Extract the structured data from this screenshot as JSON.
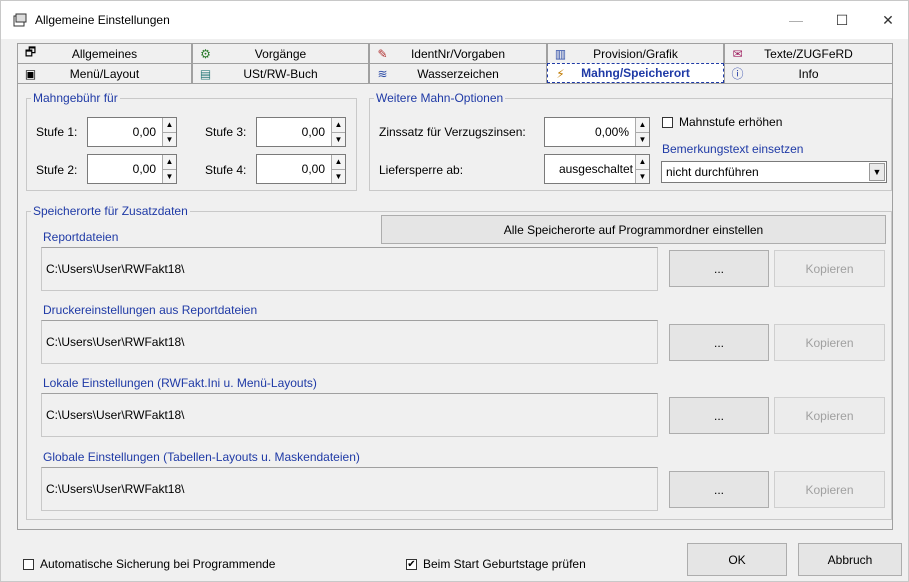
{
  "window": {
    "title": "Allgemeine Einstellungen",
    "minimize_glyph": "—",
    "maximize_glyph": "☐",
    "close_glyph": "✕"
  },
  "tabs": {
    "row1": [
      {
        "label": "Allgemeines",
        "icon": "settings-icon"
      },
      {
        "label": "Vorgänge",
        "icon": "process-icon"
      },
      {
        "label": "IdentNr/Vorgaben",
        "icon": "ident-icon"
      },
      {
        "label": "Provision/Grafik",
        "icon": "chart-icon"
      },
      {
        "label": "Texte/ZUGFeRD",
        "icon": "text-icon"
      }
    ],
    "row2": [
      {
        "label": "Menü/Layout",
        "icon": "layout-icon"
      },
      {
        "label": "USt/RW-Buch",
        "icon": "book-icon"
      },
      {
        "label": "Wasserzeichen",
        "icon": "watermark-icon"
      },
      {
        "label": "Mahng/Speicherort",
        "icon": "reminder-icon"
      },
      {
        "label": "Info",
        "icon": "info-icon"
      }
    ],
    "active": "Mahng/Speicherort"
  },
  "mahngebuehr": {
    "legend": "Mahngebühr für",
    "stufe1": {
      "label": "Stufe 1:",
      "value": "0,00"
    },
    "stufe2": {
      "label": "Stufe 2:",
      "value": "0,00"
    },
    "stufe3": {
      "label": "Stufe 3:",
      "value": "0,00"
    },
    "stufe4": {
      "label": "Stufe 4:",
      "value": "0,00"
    }
  },
  "mahnoptionen": {
    "legend": "Weitere Mahn-Optionen",
    "zinssatz_label": "Zinssatz für Verzugszinsen:",
    "zinssatz_value": "0,00%",
    "liefersperre_label": "Liefersperre ab:",
    "liefersperre_value": "ausgeschaltet",
    "mahnstufe_checkbox": {
      "label": "Mahnstufe erhöhen",
      "checked": false
    },
    "bemerkung_label": "Bemerkungstext einsetzen",
    "bemerkung_value": "nicht durchführen"
  },
  "speicherorte": {
    "legend": "Speicherorte für Zusatzdaten",
    "set_all_button": "Alle Speicherorte auf Programmordner einstellen",
    "browse_label": "...",
    "copy_label": "Kopieren",
    "entries": [
      {
        "label": "Reportdateien",
        "path": "C:\\Users\\User\\RWFakt18\\"
      },
      {
        "label": "Druckereinstellungen aus Reportdateien",
        "path": "C:\\Users\\User\\RWFakt18\\"
      },
      {
        "label": "Lokale Einstellungen (RWFakt.Ini u. Menü-Layouts)",
        "path": "C:\\Users\\User\\RWFakt18\\"
      },
      {
        "label": "Globale Einstellungen (Tabellen-Layouts u. Maskendateien)",
        "path": "C:\\Users\\User\\RWFakt18\\"
      }
    ]
  },
  "footer": {
    "auto_backup": {
      "label": "Automatische Sicherung bei Programmende",
      "checked": false
    },
    "birthdays": {
      "label": "Beim Start Geburtstage prüfen",
      "checked": true,
      "mark": "✔"
    },
    "ok_label": "OK",
    "cancel_label": "Abbruch"
  },
  "colors": {
    "accent": "#1f3aa6",
    "background": "#f0f0f0"
  }
}
